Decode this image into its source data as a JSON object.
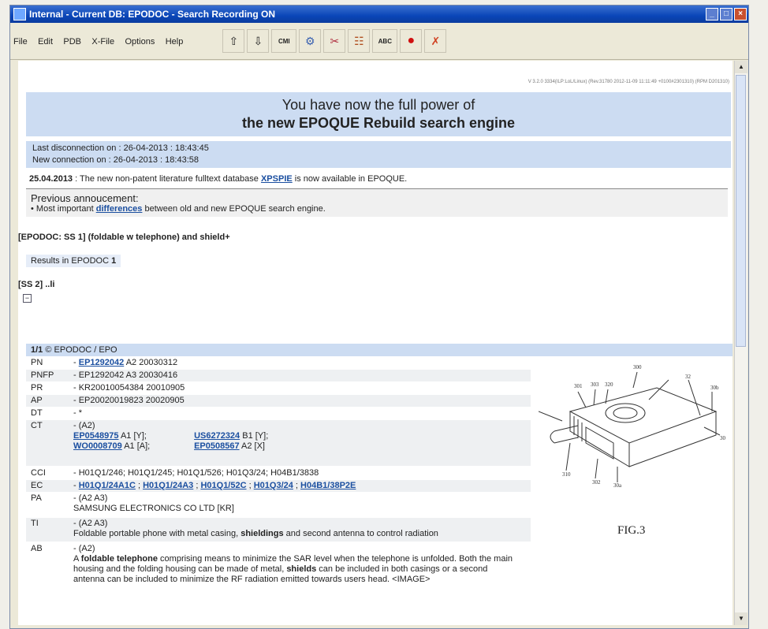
{
  "window": {
    "title": "Internal - Current DB: EPODOC - Search Recording ON"
  },
  "menu": {
    "file": "File",
    "edit": "Edit",
    "pdb": "PDB",
    "xfile": "X-File",
    "options": "Options",
    "help": "Help"
  },
  "toolbar": {
    "up_icon": "arrow-up-icon",
    "down_icon": "arrow-down-icon",
    "cmi_label": "CMI",
    "abc_label": "ABC"
  },
  "page": {
    "version": "V 3.2.0 3334(ILP:LoL/Linux) (Rev.31780 2012-11-09 11:11:49 +0100#2301310) (RPM D201310)",
    "banner_line1": "You have now the full power of",
    "banner_line2": "the new EPOQUE Rebuild search engine",
    "last_disconnection": "Last disconnection on : 26-04-2013 : 18:43:45",
    "new_connection": "New connection on : 26-04-2013 : 18:43:58",
    "news_date": "25.04.2013",
    "news_text": ": The new non-patent literature fulltext database",
    "news_link": "XPSPIE",
    "news_tail": "is now available in EPOQUE.",
    "prev_heading": "Previous annoucement:",
    "prev_prefix": "• Most important",
    "prev_link": "differences",
    "prev_tail": "between old and new EPOQUE search engine.",
    "query": "[EPODOC: SS 1]  (foldable w telephone) and shield+",
    "results_label": "Results in  EPODOC",
    "results_count": "1",
    "ss2": "[SS 2]  ..li",
    "record_head": "1/1",
    "record_source": "EPODOC / EPO"
  },
  "record": {
    "PN": {
      "key": "PN",
      "link": "EP1292042",
      "tail": "A2 20030312"
    },
    "PNFP": {
      "key": "PNFP",
      "val": "- EP1292042 A3 20030416"
    },
    "PR": {
      "key": "PR",
      "val": "- KR20010054384 20010905"
    },
    "AP": {
      "key": "AP",
      "val": "- EP20020019823 20020905"
    },
    "DT": {
      "key": "DT",
      "val": "- *"
    },
    "CT": {
      "key": "CT",
      "line1": "- (A2)",
      "c1": "EP0548975",
      "c1t": "A1 [Y];",
      "c2": "US6272324",
      "c2t": "B1 [Y];",
      "c3": "WO0008709",
      "c3t": "A1 [A];",
      "c4": "EP0508567",
      "c4t": "A2 [X]"
    },
    "CCI": {
      "key": "CCI",
      "val": "- H01Q1/246; H01Q1/245; H01Q1/526; H01Q3/24; H04B1/3838"
    },
    "EC": {
      "key": "EC",
      "e1": "H01Q1/24A1C",
      "e2": "H01Q1/24A3",
      "e3": "H01Q1/52C",
      "e4": "H01Q3/24",
      "e5": "H04B1/38P2E"
    },
    "PA": {
      "key": "PA",
      "line1": "- (A2 A3)",
      "line2": "SAMSUNG ELECTRONICS CO LTD [KR]"
    },
    "TI": {
      "key": "TI",
      "line1": "- (A2 A3)",
      "line2a": "Foldable portable phone with metal casing,",
      "line2b": "shieldings",
      "line2c": "and second antenna to control radiation"
    },
    "AB": {
      "key": "AB",
      "line1": "- (A2)",
      "p1": "A",
      "p1b": "foldable telephone",
      "p1c": "comprising means to minimize the SAR level when the telephone is unfolded. Both the main housing and the folding housing can be made of metal,",
      "p1d": "shields",
      "p1e": "can be included in both casings or a second antenna can be included to minimize the RF radiation emitted towards users head. <IMAGE>"
    }
  },
  "figure": {
    "caption": "FIG.3",
    "labels": [
      "300",
      "32",
      "301",
      "303",
      "320",
      "30b",
      "30",
      "310",
      "302",
      "30a"
    ]
  }
}
